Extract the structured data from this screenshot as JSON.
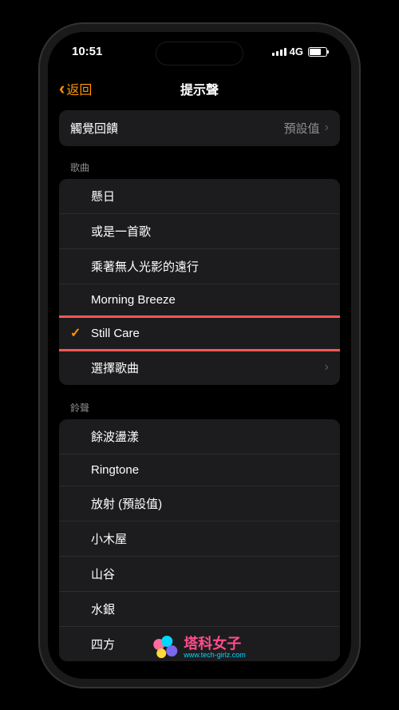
{
  "statusBar": {
    "time": "10:51",
    "network": "4G"
  },
  "nav": {
    "back": "返回",
    "title": "提示聲"
  },
  "haptic": {
    "label": "觸覺回饋",
    "value": "預設值"
  },
  "sections": {
    "songs": {
      "header": "歌曲",
      "items": [
        "懸日",
        "或是一首歌",
        "乘著無人光影的遠行",
        "Morning Breeze",
        "Still Care",
        "選擇歌曲"
      ],
      "selectedIndex": 4,
      "chevronIndex": 5,
      "highlightIndex": 4
    },
    "ringtones": {
      "header": "鈴聲",
      "items": [
        "餘波盪漾",
        "Ringtone",
        "放射 (預設值)",
        "小木屋",
        "山谷",
        "水銀",
        "四方"
      ]
    }
  },
  "watermark": {
    "title": "塔科女子",
    "url": "www.tech-girlz.com"
  }
}
